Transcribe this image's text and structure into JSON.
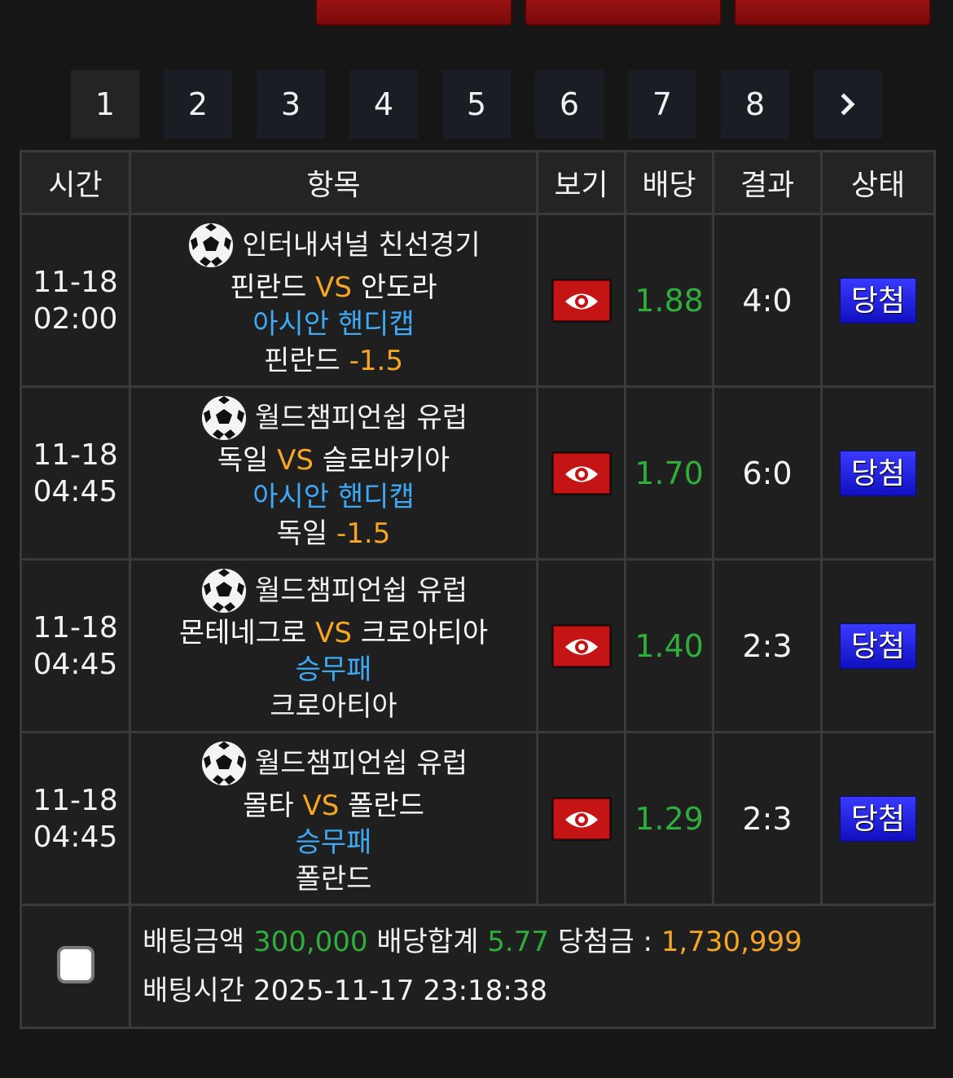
{
  "pagination": {
    "pages": [
      "1",
      "2",
      "3",
      "4",
      "5",
      "6",
      "7",
      "8"
    ],
    "active_page": "1",
    "next_icon": "chevron-right-icon"
  },
  "table": {
    "headers": [
      "시간",
      "항목",
      "보기",
      "배당",
      "결과",
      "상태"
    ],
    "rows": [
      {
        "date": "11-18",
        "time": "02:00",
        "league": "인터내셔널 친선경기",
        "home": "핀란드",
        "vs": "VS",
        "away": "안도라",
        "market": "아시안 핸디캡",
        "pick": "핀란드",
        "pick_line": "-1.5",
        "odds": "1.88",
        "result": "4:0",
        "status": "당첨"
      },
      {
        "date": "11-18",
        "time": "04:45",
        "league": "월드챔피언쉽 유럽",
        "home": "독일",
        "vs": "VS",
        "away": "슬로바키아",
        "market": "아시안 핸디캡",
        "pick": "독일",
        "pick_line": "-1.5",
        "odds": "1.70",
        "result": "6:0",
        "status": "당첨"
      },
      {
        "date": "11-18",
        "time": "04:45",
        "league": "월드챔피언쉽 유럽",
        "home": "몬테네그로",
        "vs": "VS",
        "away": "크로아티아",
        "market": "승무패",
        "pick": "크로아티아",
        "pick_line": "",
        "odds": "1.40",
        "result": "2:3",
        "status": "당첨"
      },
      {
        "date": "11-18",
        "time": "04:45",
        "league": "월드챔피언쉽 유럽",
        "home": "몰타",
        "vs": "VS",
        "away": "폴란드",
        "market": "승무패",
        "pick": "폴란드",
        "pick_line": "",
        "odds": "1.29",
        "result": "2:3",
        "status": "당첨"
      }
    ]
  },
  "summary": {
    "bet_amount_label": "배팅금액",
    "bet_amount": "300,000",
    "odds_total_label": "배당합계",
    "odds_total": "5.77",
    "win_label": "당첨금 :",
    "win_amount": "1,730,999",
    "bet_time_label": "배팅시간",
    "bet_time": "2025-11-17 23:18:38"
  },
  "colors": {
    "background": "#161616",
    "odds_green": "#2fae3c",
    "accent_orange": "#f5a623",
    "market_blue": "#3ea9f5",
    "status_blue": "#2020e0",
    "view_red": "#c41414"
  }
}
